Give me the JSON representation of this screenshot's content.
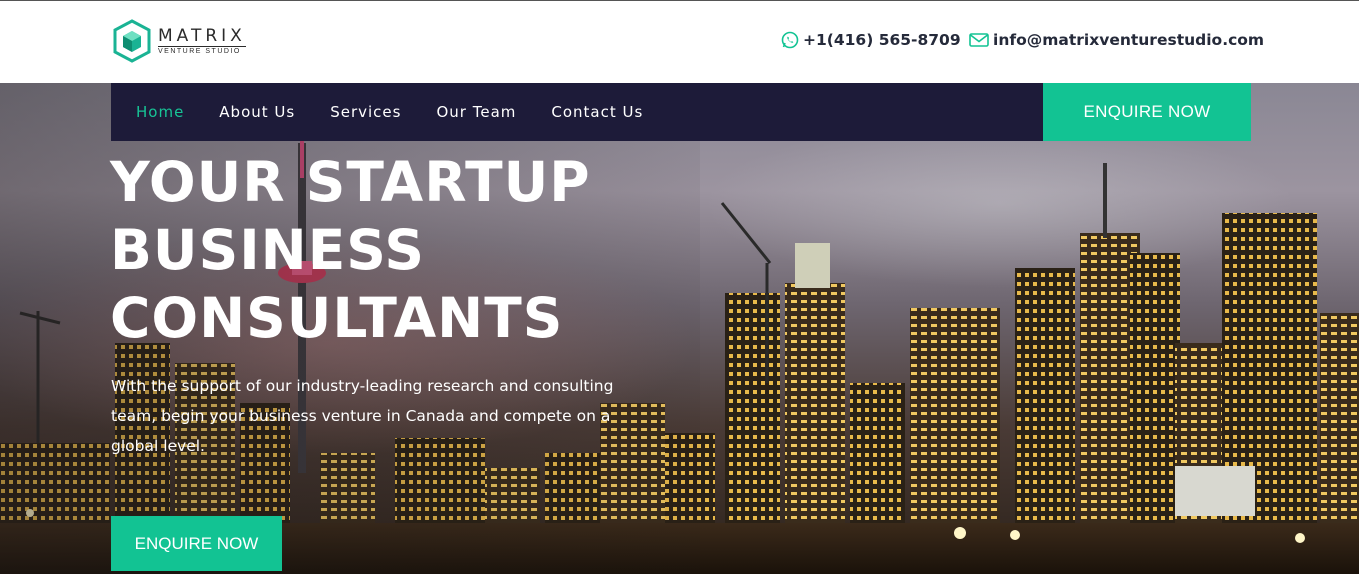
{
  "brand": {
    "name": "MATRIX",
    "tagline": "VENTURE STUDIO",
    "accent_color": "#12c393",
    "nav_bg_color": "#1d1b39"
  },
  "header": {
    "phone": {
      "icon": "whatsapp-icon",
      "text": "+1(416) 565-8709"
    },
    "email": {
      "icon": "mail-icon",
      "text": "info@matrixventurestudio.com"
    }
  },
  "nav": {
    "items": [
      {
        "label": "Home",
        "active": true
      },
      {
        "label": "About Us",
        "active": false
      },
      {
        "label": "Services",
        "active": false
      },
      {
        "label": "Our Team",
        "active": false
      },
      {
        "label": "Contact Us",
        "active": false
      }
    ],
    "cta_label": "ENQUIRE NOW"
  },
  "hero": {
    "title_lines": [
      "YOUR STARTUP",
      "BUSINESS",
      "CONSULTANTS"
    ],
    "description": "With the support of our industry-leading research and consulting team, begin your business venture in Canada and compete on a global level.",
    "cta_label": "ENQUIRE NOW"
  }
}
